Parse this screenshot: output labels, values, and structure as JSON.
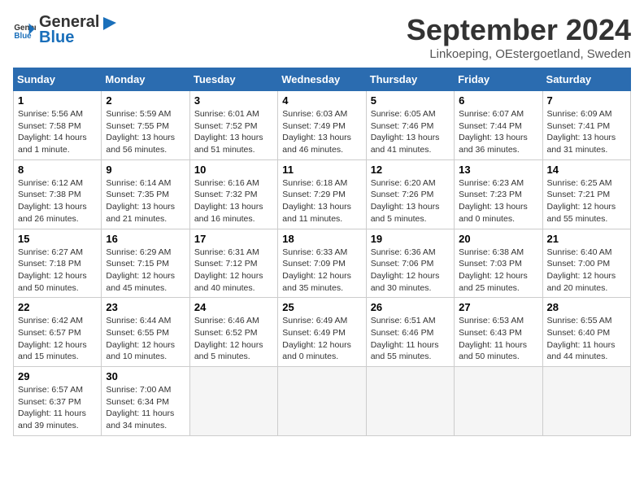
{
  "logo": {
    "general": "General",
    "blue": "Blue"
  },
  "title": "September 2024",
  "subtitle": "Linkoeping, OEstergoetland, Sweden",
  "days_header": [
    "Sunday",
    "Monday",
    "Tuesday",
    "Wednesday",
    "Thursday",
    "Friday",
    "Saturday"
  ],
  "weeks": [
    [
      {
        "num": "1",
        "info": "Sunrise: 5:56 AM\nSunset: 7:58 PM\nDaylight: 14 hours\nand 1 minute."
      },
      {
        "num": "2",
        "info": "Sunrise: 5:59 AM\nSunset: 7:55 PM\nDaylight: 13 hours\nand 56 minutes."
      },
      {
        "num": "3",
        "info": "Sunrise: 6:01 AM\nSunset: 7:52 PM\nDaylight: 13 hours\nand 51 minutes."
      },
      {
        "num": "4",
        "info": "Sunrise: 6:03 AM\nSunset: 7:49 PM\nDaylight: 13 hours\nand 46 minutes."
      },
      {
        "num": "5",
        "info": "Sunrise: 6:05 AM\nSunset: 7:46 PM\nDaylight: 13 hours\nand 41 minutes."
      },
      {
        "num": "6",
        "info": "Sunrise: 6:07 AM\nSunset: 7:44 PM\nDaylight: 13 hours\nand 36 minutes."
      },
      {
        "num": "7",
        "info": "Sunrise: 6:09 AM\nSunset: 7:41 PM\nDaylight: 13 hours\nand 31 minutes."
      }
    ],
    [
      {
        "num": "8",
        "info": "Sunrise: 6:12 AM\nSunset: 7:38 PM\nDaylight: 13 hours\nand 26 minutes."
      },
      {
        "num": "9",
        "info": "Sunrise: 6:14 AM\nSunset: 7:35 PM\nDaylight: 13 hours\nand 21 minutes."
      },
      {
        "num": "10",
        "info": "Sunrise: 6:16 AM\nSunset: 7:32 PM\nDaylight: 13 hours\nand 16 minutes."
      },
      {
        "num": "11",
        "info": "Sunrise: 6:18 AM\nSunset: 7:29 PM\nDaylight: 13 hours\nand 11 minutes."
      },
      {
        "num": "12",
        "info": "Sunrise: 6:20 AM\nSunset: 7:26 PM\nDaylight: 13 hours\nand 5 minutes."
      },
      {
        "num": "13",
        "info": "Sunrise: 6:23 AM\nSunset: 7:23 PM\nDaylight: 13 hours\nand 0 minutes."
      },
      {
        "num": "14",
        "info": "Sunrise: 6:25 AM\nSunset: 7:21 PM\nDaylight: 12 hours\nand 55 minutes."
      }
    ],
    [
      {
        "num": "15",
        "info": "Sunrise: 6:27 AM\nSunset: 7:18 PM\nDaylight: 12 hours\nand 50 minutes."
      },
      {
        "num": "16",
        "info": "Sunrise: 6:29 AM\nSunset: 7:15 PM\nDaylight: 12 hours\nand 45 minutes."
      },
      {
        "num": "17",
        "info": "Sunrise: 6:31 AM\nSunset: 7:12 PM\nDaylight: 12 hours\nand 40 minutes."
      },
      {
        "num": "18",
        "info": "Sunrise: 6:33 AM\nSunset: 7:09 PM\nDaylight: 12 hours\nand 35 minutes."
      },
      {
        "num": "19",
        "info": "Sunrise: 6:36 AM\nSunset: 7:06 PM\nDaylight: 12 hours\nand 30 minutes."
      },
      {
        "num": "20",
        "info": "Sunrise: 6:38 AM\nSunset: 7:03 PM\nDaylight: 12 hours\nand 25 minutes."
      },
      {
        "num": "21",
        "info": "Sunrise: 6:40 AM\nSunset: 7:00 PM\nDaylight: 12 hours\nand 20 minutes."
      }
    ],
    [
      {
        "num": "22",
        "info": "Sunrise: 6:42 AM\nSunset: 6:57 PM\nDaylight: 12 hours\nand 15 minutes."
      },
      {
        "num": "23",
        "info": "Sunrise: 6:44 AM\nSunset: 6:55 PM\nDaylight: 12 hours\nand 10 minutes."
      },
      {
        "num": "24",
        "info": "Sunrise: 6:46 AM\nSunset: 6:52 PM\nDaylight: 12 hours\nand 5 minutes."
      },
      {
        "num": "25",
        "info": "Sunrise: 6:49 AM\nSunset: 6:49 PM\nDaylight: 12 hours\nand 0 minutes."
      },
      {
        "num": "26",
        "info": "Sunrise: 6:51 AM\nSunset: 6:46 PM\nDaylight: 11 hours\nand 55 minutes."
      },
      {
        "num": "27",
        "info": "Sunrise: 6:53 AM\nSunset: 6:43 PM\nDaylight: 11 hours\nand 50 minutes."
      },
      {
        "num": "28",
        "info": "Sunrise: 6:55 AM\nSunset: 6:40 PM\nDaylight: 11 hours\nand 44 minutes."
      }
    ],
    [
      {
        "num": "29",
        "info": "Sunrise: 6:57 AM\nSunset: 6:37 PM\nDaylight: 11 hours\nand 39 minutes."
      },
      {
        "num": "30",
        "info": "Sunrise: 7:00 AM\nSunset: 6:34 PM\nDaylight: 11 hours\nand 34 minutes."
      },
      {
        "num": "",
        "info": ""
      },
      {
        "num": "",
        "info": ""
      },
      {
        "num": "",
        "info": ""
      },
      {
        "num": "",
        "info": ""
      },
      {
        "num": "",
        "info": ""
      }
    ]
  ]
}
